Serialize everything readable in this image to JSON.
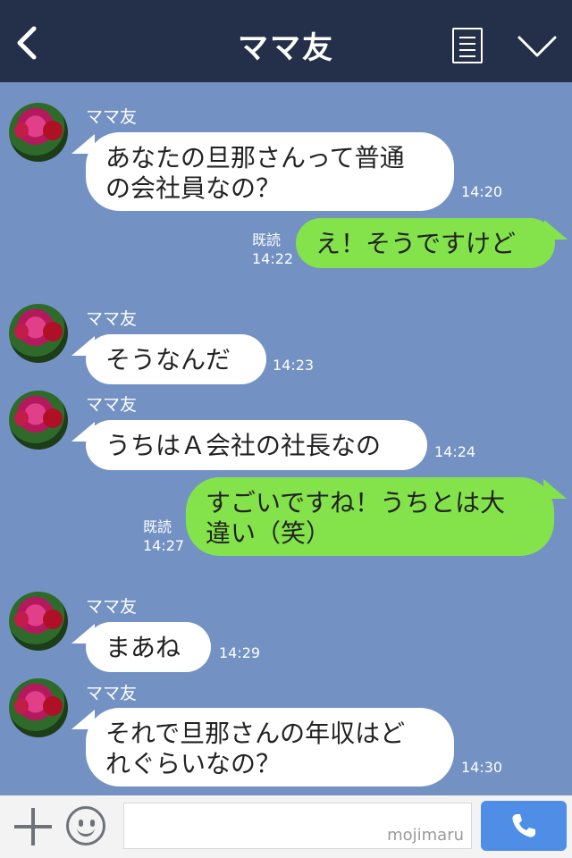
{
  "header": {
    "title": "ママ友"
  },
  "messages": [
    {
      "side": "in",
      "name": "ママ友",
      "text": "あなたの旦那さんって普通\nの会社員なの？",
      "time": "14:20"
    },
    {
      "side": "out",
      "text": "え！そうですけど",
      "read": "既読",
      "time": "14:22"
    },
    {
      "side": "in",
      "name": "ママ友",
      "text": "そうなんだ",
      "time": "14:23"
    },
    {
      "side": "in",
      "name": "ママ友",
      "text": "うちはＡ会社の社長なの",
      "time": "14:24"
    },
    {
      "side": "out",
      "text": "すごいですね！うちとは大\n違い（笑）",
      "read": "既読",
      "time": "14:27"
    },
    {
      "side": "in",
      "name": "ママ友",
      "text": "まあね",
      "time": "14:29"
    },
    {
      "side": "in",
      "name": "ママ友",
      "text": "それで旦那さんの年収はど\nれぐらいなの？",
      "time": "14:30"
    }
  ],
  "footer": {
    "watermark": "mojimaru"
  },
  "colors": {
    "header_bg": "#24304a",
    "chat_bg": "#7392c3",
    "outgoing_bubble": "#84e34b",
    "send_button": "#4f8ee6"
  },
  "icons": [
    "back-chevron-icon",
    "menu-list-icon",
    "chevron-down-icon",
    "plus-icon",
    "smiley-icon",
    "phone-icon"
  ]
}
